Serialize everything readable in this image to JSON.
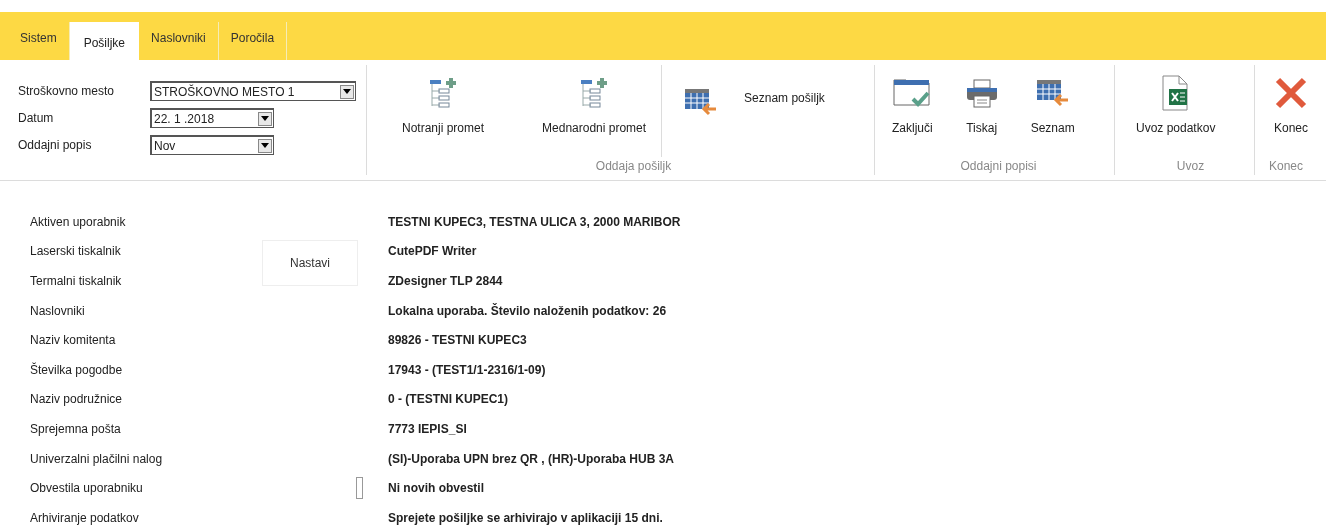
{
  "tabs": [
    {
      "label": "Sistem",
      "selected": false
    },
    {
      "label": "Pošiljke",
      "selected": true
    },
    {
      "label": "Naslovniki",
      "selected": false
    },
    {
      "label": "Poročila",
      "selected": false
    }
  ],
  "fields": [
    {
      "label": "Stroškovno mesto",
      "value": "STROŠKOVNO MESTO 1"
    },
    {
      "label": "Datum",
      "value": "22. 1 .2018"
    },
    {
      "label": "Oddajni popis",
      "value": "Nov"
    }
  ],
  "groups": [
    {
      "label": "Oddaja pošiljk",
      "items": [
        {
          "label": "Notranji promet",
          "kind": "large"
        },
        {
          "label": "Mednarodni promet",
          "kind": "large"
        },
        {
          "label": "Seznam pošiljk",
          "kind": "side"
        }
      ]
    },
    {
      "label": "Oddajni popisi",
      "items": [
        {
          "label": "Zaključi",
          "kind": "large"
        },
        {
          "label": "Tiskaj",
          "kind": "large"
        },
        {
          "label": "Seznam",
          "kind": "large"
        }
      ]
    },
    {
      "label": "Uvoz",
      "items": [
        {
          "label": "Uvoz podatkov",
          "kind": "large"
        }
      ]
    },
    {
      "label": "Konec",
      "items": [
        {
          "label": "Konec",
          "kind": "large"
        }
      ]
    }
  ],
  "settings_button": "Nastavi",
  "info_rows": [
    {
      "label": "Aktiven uporabnik",
      "value": "TESTNI KUPEC3, TESTNA ULICA 3, 2000 MARIBOR"
    },
    {
      "label": "Laserski tiskalnik",
      "value": "CutePDF Writer"
    },
    {
      "label": "Termalni tiskalnik",
      "value": "ZDesigner TLP 2844"
    },
    {
      "label": "Naslovniki",
      "value": "Lokalna uporaba. Število naloženih podatkov: 26"
    },
    {
      "label": "Naziv komitenta",
      "value": "89826 - TESTNI KUPEC3"
    },
    {
      "label": "Številka pogodbe",
      "value": "17943 - (TEST1/1-2316/1-09)"
    },
    {
      "label": "Naziv podružnice",
      "value": "0 - (TESTNI KUPEC1)"
    },
    {
      "label": "Sprejemna pošta",
      "value": "7773 IEPIS_SI"
    },
    {
      "label": "Univerzalni plačilni nalog",
      "value": "(SI)-Uporaba UPN brez QR , (HR)-Uporaba HUB 3A"
    },
    {
      "label": "Obvestila uporabniku",
      "value": "Ni novih obvestil",
      "marker": true
    },
    {
      "label": "Arhiviranje podatkov",
      "value": "Sprejete pošiljke se arhivirajo v aplikaciji 15 dni."
    }
  ]
}
